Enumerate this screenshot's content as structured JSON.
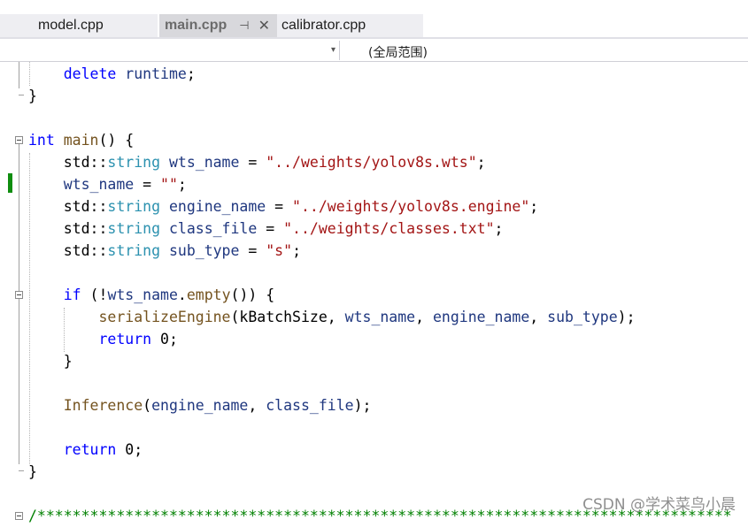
{
  "tabs": [
    {
      "label": "model.cpp",
      "active": false
    },
    {
      "label": "main.cpp",
      "active": true,
      "pin_glyph": "⊣",
      "close_glyph": "✕"
    },
    {
      "label": "calibrator.cpp",
      "active": false
    }
  ],
  "navbar": {
    "left_value": "",
    "dropdown_glyph": "▾",
    "scope": "(全局范围)"
  },
  "code": {
    "l1": [
      "    ",
      "delete",
      " ",
      "runtime",
      ";"
    ],
    "l2": "}",
    "l4": [
      "int",
      " ",
      "main",
      "() {"
    ],
    "l5": [
      "    std::",
      "string",
      " ",
      "wts_name",
      " = ",
      "\"../weights/yolov8s.wts\"",
      ";"
    ],
    "l6": [
      "    ",
      "wts_name",
      " = ",
      "\"\"",
      ";"
    ],
    "l7": [
      "    std::",
      "string",
      " ",
      "engine_name",
      " = ",
      "\"../weights/yolov8s.engine\"",
      ";"
    ],
    "l8": [
      "    std::",
      "string",
      " ",
      "class_file",
      " = ",
      "\"../weights/classes.txt\"",
      ";"
    ],
    "l9": [
      "    std::",
      "string",
      " ",
      "sub_type",
      " = ",
      "\"s\"",
      ";"
    ],
    "l11": [
      "    ",
      "if",
      " (!",
      "wts_name",
      ".",
      "empty",
      "()) {"
    ],
    "l12": [
      "        ",
      "serializeEngine",
      "(kBatchSize, ",
      "wts_name",
      ", ",
      "engine_name",
      ", ",
      "sub_type",
      ");"
    ],
    "l13": [
      "        ",
      "return",
      " 0;"
    ],
    "l14": "    }",
    "l16": [
      "    ",
      "Inference",
      "(",
      "engine_name",
      ", ",
      "class_file",
      ");"
    ],
    "l18": [
      "    ",
      "return",
      " 0;"
    ],
    "l19": "}",
    "l20": "/*******************************************************************************"
  },
  "colors": {
    "keyword": "#0000ff",
    "type": "#2b91af",
    "variable": "#1f377f",
    "function": "#74531f",
    "string": "#a31515",
    "comment": "#008000",
    "change_bar": "#108d10"
  },
  "watermark": "CSDN @学术菜鸟小晨"
}
